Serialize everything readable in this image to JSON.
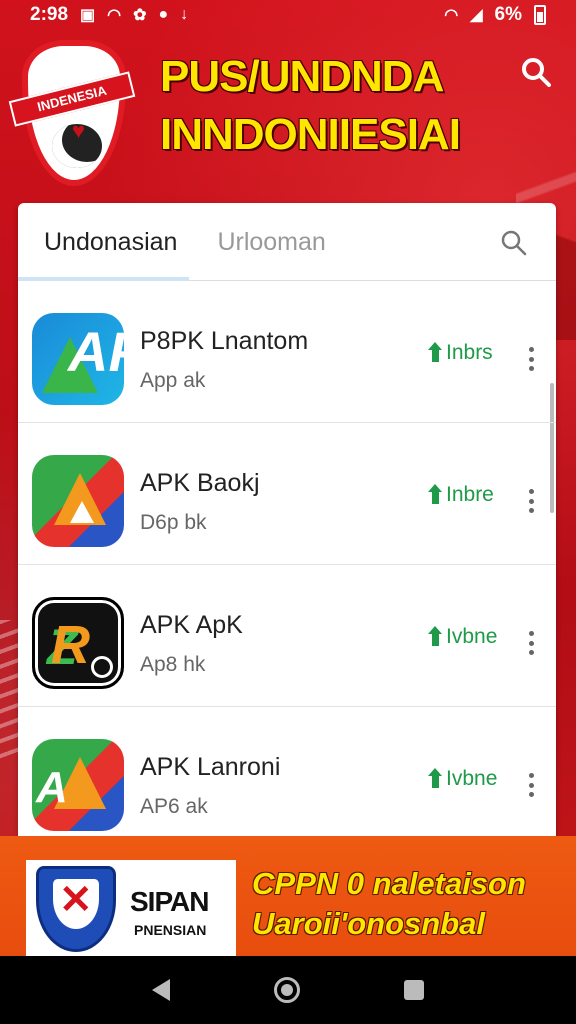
{
  "status_bar": {
    "time": "2:98",
    "left_icons": [
      "mail-icon",
      "wifi-icon",
      "notification-icon",
      "alert-icon",
      "download-icon"
    ],
    "battery": "6%"
  },
  "header": {
    "logo_text": "INDENESIA",
    "title_line1": "PUS/UNDNDA",
    "title_line2": "INNDONIIESIAI"
  },
  "tabs": [
    {
      "label": "Undonasian",
      "active": true
    },
    {
      "label": "Urlooman",
      "active": false
    }
  ],
  "apps": [
    {
      "name": "P8PK Lnantom",
      "sub": "App ak",
      "action": "Inbrs",
      "icon_letter": "AP"
    },
    {
      "name": "APK Baokj",
      "sub": "D6p bk",
      "action": "Inbre",
      "icon_letter": ""
    },
    {
      "name": "APK ApK",
      "sub": "Ap8 hk",
      "action": "Ivbne",
      "icon_letter": "R"
    },
    {
      "name": "APK Lanroni",
      "sub": "AP6 ak",
      "action": "Ivbne",
      "icon_letter": "A"
    }
  ],
  "banner": {
    "brand": "SIPAN",
    "brand_sub": "PNENSIAN",
    "line1": "CPPN 0 naletaison",
    "line2": "Uaroii'onosnbal"
  },
  "colors": {
    "background_red": "#c8101a",
    "title_yellow": "#ffe600",
    "install_green": "#1e9a48",
    "banner_orange": "#ee5a12"
  }
}
